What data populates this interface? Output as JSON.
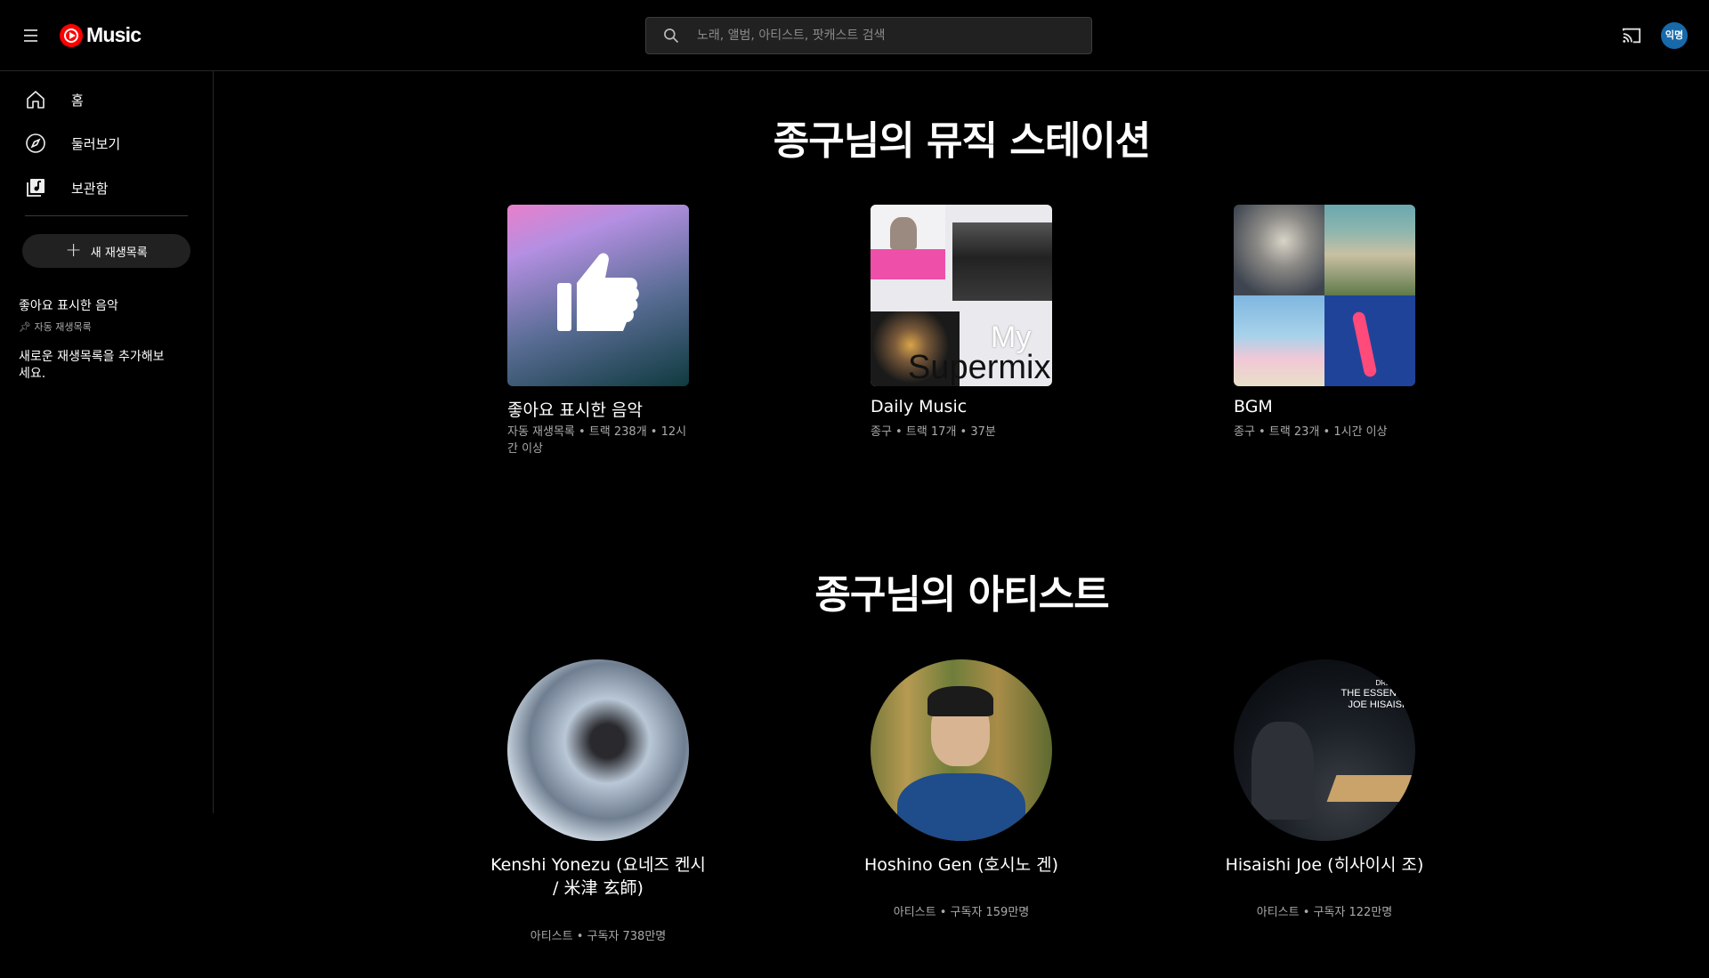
{
  "header": {
    "logo_text": "Music",
    "search_placeholder": "노래, 앨범, 아티스트, 팟캐스트 검색",
    "avatar_text": "익명"
  },
  "sidebar": {
    "nav": [
      {
        "label": "홈",
        "icon": "home-icon"
      },
      {
        "label": "둘러보기",
        "icon": "explore-compass-icon"
      },
      {
        "label": "보관함",
        "icon": "library-icon"
      }
    ],
    "new_playlist_label": "새 재생목록",
    "liked_playlist": {
      "title": "좋아요 표시한 음악",
      "subtitle": "자동 재생목록"
    },
    "hint": "새로운 재생목록을 추가해보세요."
  },
  "stations": {
    "title": "종구님의 뮤직 스테이션",
    "cards": [
      {
        "name": "좋아요 표시한 음악",
        "sub": "자동 재생목록 • 트랙 238개 • 12시간 이상"
      },
      {
        "name": "Daily Music",
        "sub": "종구 • 트랙 17개 • 37분",
        "overlay_top": "My",
        "overlay_bottom": "Supermix"
      },
      {
        "name": "BGM",
        "sub": "종구 • 트랙 23개 • 1시간 이상"
      }
    ]
  },
  "artists": {
    "title": "종구님의 아티스트",
    "items": [
      {
        "name": "Kenshi Yonezu (요네즈 켄시 / 米津 玄師)",
        "sub": "아티스트 • 구독자 738만명"
      },
      {
        "name": "Hoshino Gen (호시노 겐)",
        "sub": "아티스트 • 구독자 159만명"
      },
      {
        "name": "Hisaishi Joe (히사이시 조)",
        "sub": "아티스트 • 구독자 122만명",
        "art_line1": "DREAM SO",
        "art_line2": "THE ESSENTIA",
        "art_line3": "JOE HISAISHI"
      }
    ]
  },
  "colors": {
    "background": "#000000",
    "accent": "#ff0000",
    "avatar": "#1769aa"
  }
}
